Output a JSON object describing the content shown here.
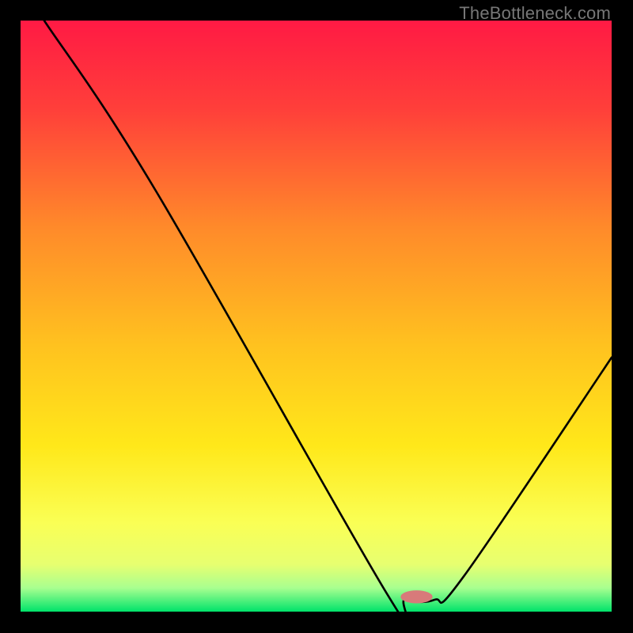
{
  "watermark": "TheBottleneck.com",
  "chart_data": {
    "type": "line",
    "title": "",
    "xlabel": "",
    "ylabel": "",
    "xlim": [
      0,
      100
    ],
    "ylim": [
      0,
      100
    ],
    "background_gradient": {
      "top": "#ff1a44",
      "upper_mid": "#ff7f27",
      "mid": "#ffd600",
      "lower_mid": "#f9ff5a",
      "bottom": "#00e36a"
    },
    "marker": {
      "x": 67,
      "y": 2.5,
      "color": "#d87a7a",
      "rx": 2.7,
      "ry": 1.1
    },
    "series": [
      {
        "name": "bottleneck-curve",
        "points": [
          {
            "x": 4,
            "y": 100
          },
          {
            "x": 23,
            "y": 71
          },
          {
            "x": 62,
            "y": 3
          },
          {
            "x": 65,
            "y": 2
          },
          {
            "x": 70,
            "y": 2
          },
          {
            "x": 75,
            "y": 6
          },
          {
            "x": 100,
            "y": 43
          }
        ]
      }
    ]
  }
}
